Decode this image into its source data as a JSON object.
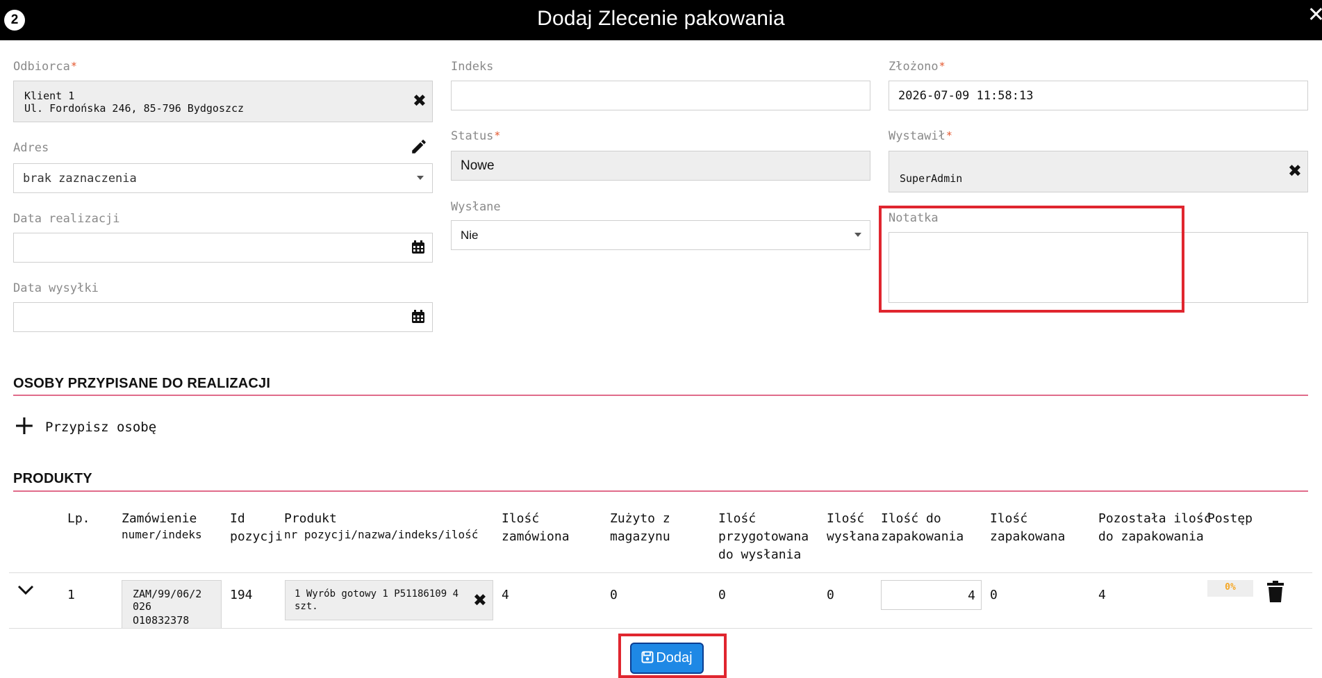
{
  "modal": {
    "badge": "2",
    "title": "Dodaj Zlecenie pakowania"
  },
  "form": {
    "odbiorca": {
      "label": "Odbiorca",
      "line1": "Klient 1",
      "line2": "Ul. Fordońska 246, 85-796 Bydgoszcz"
    },
    "adres": {
      "label": "Adres",
      "value": "brak zaznaczenia"
    },
    "data_realizacji": {
      "label": "Data realizacji",
      "value": ""
    },
    "data_wysylki": {
      "label": "Data wysyłki",
      "value": ""
    },
    "indeks": {
      "label": "Indeks",
      "value": ""
    },
    "status": {
      "label": "Status",
      "value": "Nowe"
    },
    "wyslane": {
      "label": "Wysłane",
      "value": "Nie"
    },
    "zlozono": {
      "label": "Złożono",
      "value": "2026-07-09 11:58:13"
    },
    "wystawil": {
      "label": "Wystawił",
      "value": "SuperAdmin"
    },
    "notatka": {
      "label": "Notatka",
      "value": ""
    },
    "required_mark": "*"
  },
  "osoby": {
    "title": "OSOBY PRZYPISANE DO REALIZACJI",
    "add_label": "Przypisz osobę"
  },
  "produkty": {
    "title": "PRODUKTY",
    "headers": {
      "lp": "Lp.",
      "zamowienie": "Zamówienie",
      "zamowienie_sub": "numer/indeks",
      "id_pozycji_1": "Id",
      "id_pozycji_2": "pozycji",
      "produkt": "Produkt",
      "produkt_sub": "nr pozycji/nazwa/indeks/ilość",
      "ilosc_zam_1": "Ilość",
      "ilosc_zam_2": "zamówiona",
      "zuzyto_1": "Zużyto z",
      "zuzyto_2": "magazynu",
      "przyg_1": "Ilość",
      "przyg_2": "przygotowana",
      "przyg_3": "do wysłania",
      "wyslana_1": "Ilość",
      "wyslana_2": "wysłana",
      "do_zap_1": "Ilość do",
      "do_zap_2": "zapakowania",
      "zapakowana_1": "Ilość",
      "zapakowana_2": "zapakowana",
      "pozostala_1": "Pozostała ilość",
      "pozostala_2": "do zapakowania",
      "postep": "Postęp"
    },
    "rows": [
      {
        "lp": "1",
        "zam_numer_1": "ZAM/99/06/2",
        "zam_numer_2": "026",
        "zam_indeks": "O10832378",
        "id_pozycji": "194",
        "produkt_1": "1 Wyrób gotowy 1 P51186109 4",
        "produkt_2": "szt.",
        "ilosc_zamowiona": "4",
        "zuzyto": "0",
        "przygotowana": "0",
        "wyslana": "0",
        "do_zapakowania": "4",
        "zapakowana": "0",
        "pozostala": "4",
        "postep": "0%"
      }
    ]
  },
  "actions": {
    "add_label": "Dodaj"
  },
  "colors": {
    "accent": "#1e88e5",
    "separator": "#e06b8a",
    "highlight": "#e0262f",
    "progress": "#f5a623"
  }
}
